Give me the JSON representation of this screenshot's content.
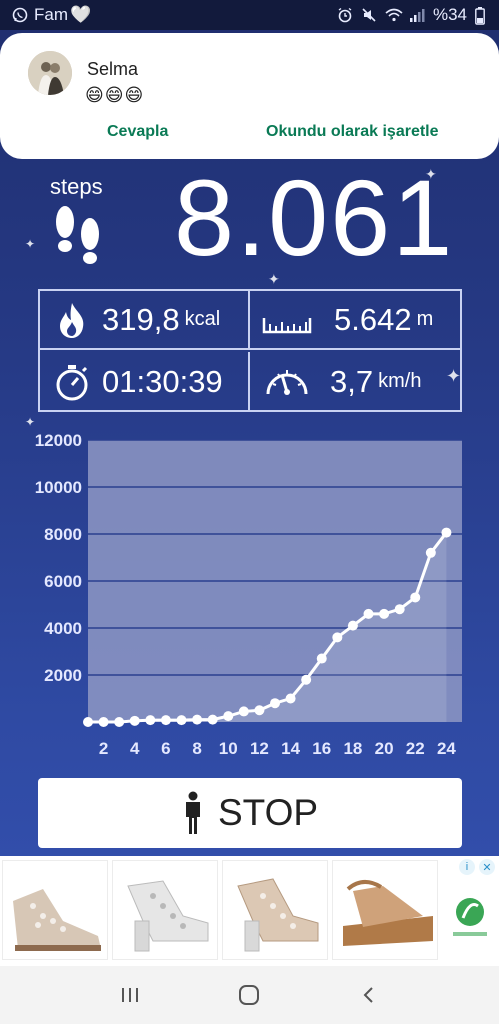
{
  "status_bar": {
    "app_label": "Fam",
    "heart": "🤍",
    "battery": "%34"
  },
  "notification": {
    "sender": "Selma",
    "message": "😄😄😄",
    "action_reply": "Cevapla",
    "action_mark_read": "Okundu olarak işaretle"
  },
  "steps": {
    "label": "steps",
    "count": "8.061"
  },
  "stats": {
    "calories": {
      "value": "319,8",
      "unit": "kcal"
    },
    "distance": {
      "value": "5.642",
      "unit": "m"
    },
    "duration": {
      "value": "01:30:39"
    },
    "speed": {
      "value": "3,7",
      "unit": "km/h"
    }
  },
  "chart_data": {
    "type": "line",
    "x": [
      1,
      2,
      3,
      4,
      5,
      6,
      7,
      8,
      9,
      10,
      11,
      12,
      13,
      14,
      15,
      16,
      17,
      18,
      19,
      20,
      21,
      22,
      23,
      24
    ],
    "x_tick_labels": [
      "2",
      "4",
      "6",
      "8",
      "10",
      "12",
      "14",
      "16",
      "18",
      "20",
      "22",
      "24"
    ],
    "y_tick_labels": [
      "2000",
      "4000",
      "6000",
      "8000",
      "10000",
      "12000"
    ],
    "ylim": [
      0,
      12000
    ],
    "series": [
      {
        "values": [
          0,
          0,
          0,
          50,
          80,
          80,
          80,
          100,
          100,
          250,
          450,
          500,
          800,
          1000,
          1800,
          2700,
          3600,
          4100,
          4600,
          4600,
          4800,
          5300,
          7200,
          8061
        ]
      }
    ],
    "grid": true,
    "colors": {
      "plot_bg": "#8e98c4",
      "line": "#ffffff",
      "grid": "#2a3f8f"
    }
  },
  "stop_button": {
    "label": "STOP"
  },
  "colors": {
    "accent_green": "#0a7a55",
    "bg_top": "#1f2e6e",
    "bg_bottom": "#3552b3"
  }
}
